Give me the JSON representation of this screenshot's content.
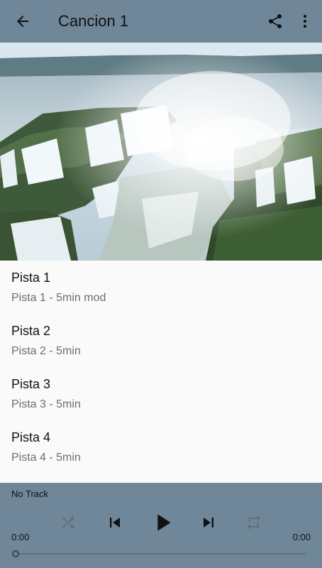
{
  "appbar": {
    "title": "Cancion 1",
    "back_icon": "arrow-back-icon",
    "share_icon": "share-icon",
    "more_icon": "more-vert-icon"
  },
  "colors": {
    "primary": "#6f8799",
    "background": "#fafafa"
  },
  "tracks": [
    {
      "title": "Pista 1",
      "subtitle": "Pista 1 - 5min mod"
    },
    {
      "title": "Pista 2",
      "subtitle": "Pista 2 - 5min"
    },
    {
      "title": "Pista 3",
      "subtitle": "Pista 3 - 5min"
    },
    {
      "title": "Pista 4",
      "subtitle": "Pista 4 - 5min"
    }
  ],
  "player": {
    "status": "No Track",
    "elapsed": "0:00",
    "duration": "0:00",
    "progress": 0
  }
}
